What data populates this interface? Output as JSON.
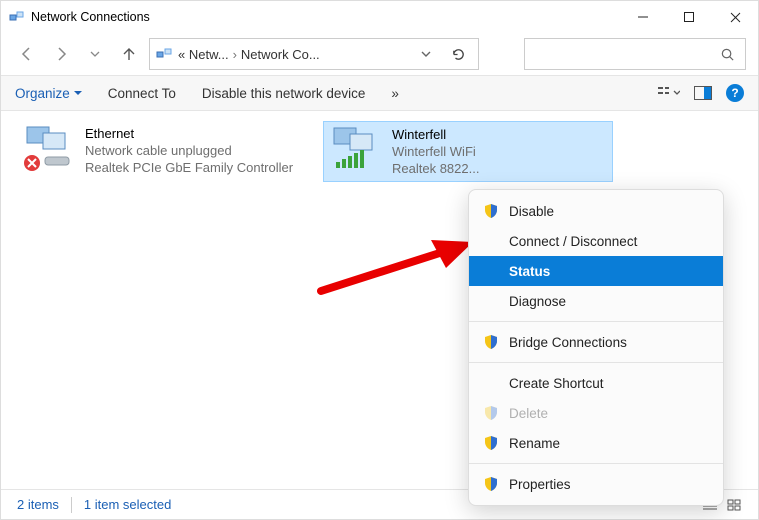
{
  "window": {
    "title": "Network Connections"
  },
  "breadcrumb": {
    "root": "«  Netw...",
    "sep": "›",
    "leaf": "Network Co..."
  },
  "toolbar": {
    "organize": "Organize",
    "connect": "Connect To",
    "disable": "Disable this network device",
    "overflow": "»"
  },
  "adapters": {
    "ethernet": {
      "name": "Ethernet",
      "status": "Network cable unplugged",
      "device": "Realtek PCIe GbE Family Controller"
    },
    "wifi": {
      "name": "Winterfell",
      "ssid": "Winterfell WiFi",
      "device": "Realtek 8822..."
    }
  },
  "ctx": {
    "disable": "Disable",
    "connect": "Connect / Disconnect",
    "status": "Status",
    "diagnose": "Diagnose",
    "bridge": "Bridge Connections",
    "shortcut": "Create Shortcut",
    "delete": "Delete",
    "rename": "Rename",
    "properties": "Properties"
  },
  "status": {
    "items": "2 items",
    "selected": "1 item selected"
  }
}
